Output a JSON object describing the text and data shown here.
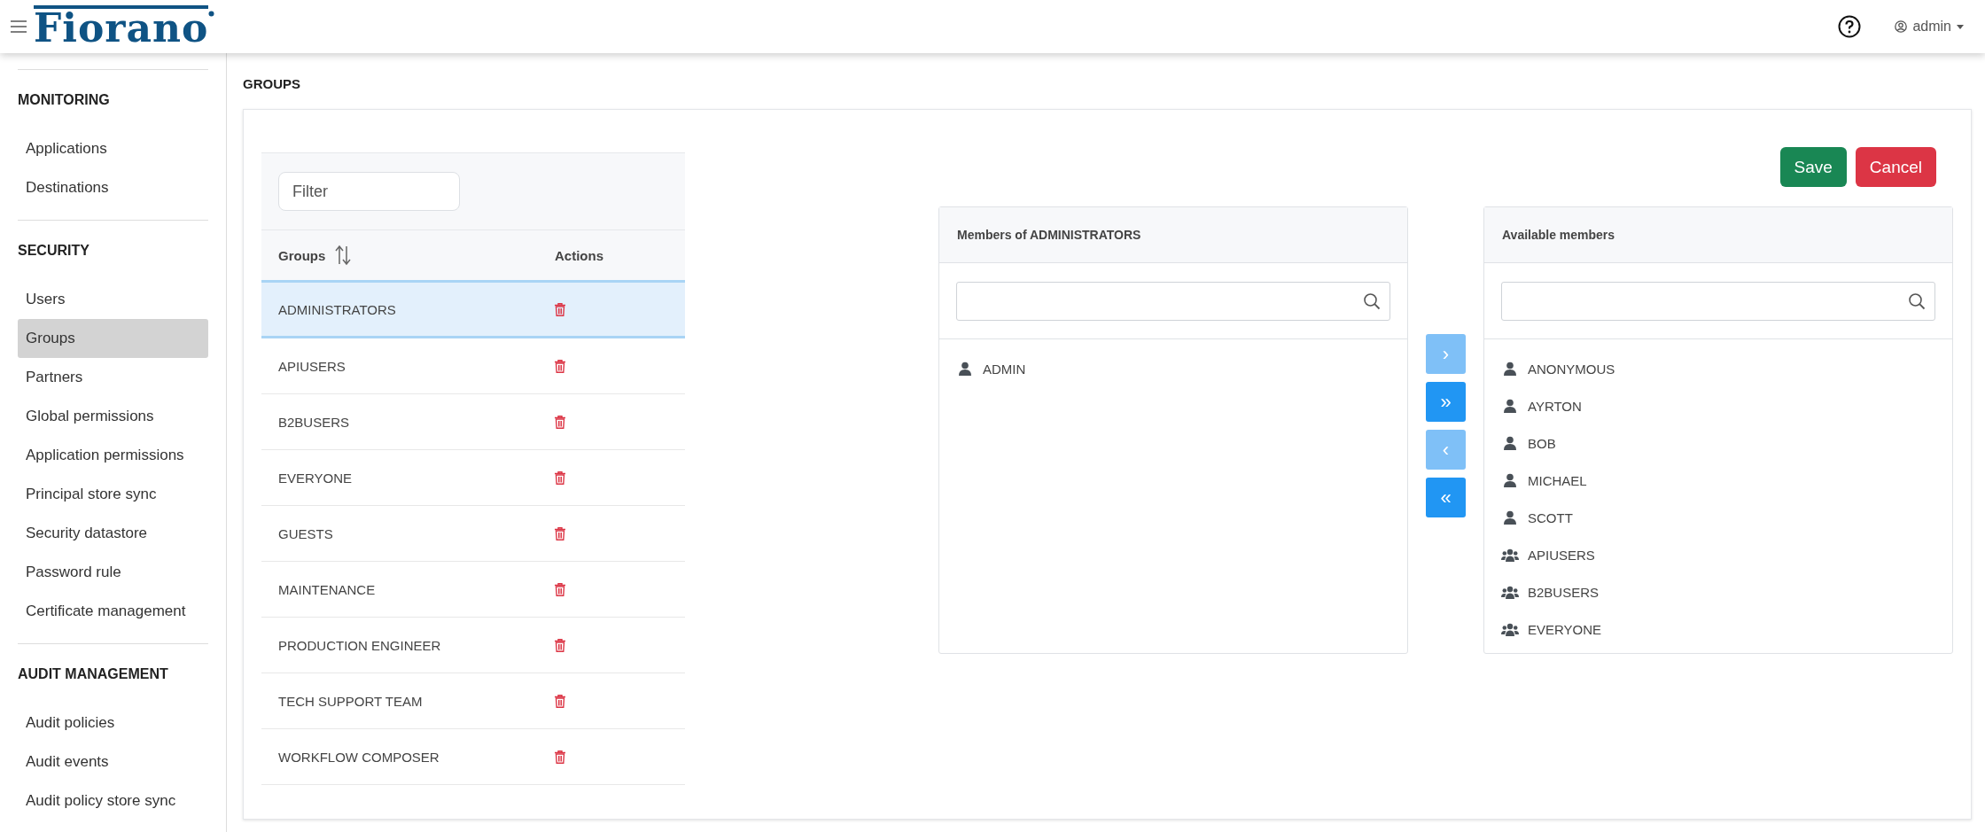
{
  "header": {
    "logo": "Fiorano",
    "user": "admin"
  },
  "sidebar": {
    "sections": [
      {
        "title": "MONITORING",
        "items": [
          {
            "label": "Applications",
            "selected": false
          },
          {
            "label": "Destinations",
            "selected": false
          }
        ]
      },
      {
        "title": "SECURITY",
        "items": [
          {
            "label": "Users",
            "selected": false
          },
          {
            "label": "Groups",
            "selected": true
          },
          {
            "label": "Partners",
            "selected": false
          },
          {
            "label": "Global permissions",
            "selected": false
          },
          {
            "label": "Application permissions",
            "selected": false
          },
          {
            "label": "Principal store sync",
            "selected": false
          },
          {
            "label": "Security datastore",
            "selected": false
          },
          {
            "label": "Password rule",
            "selected": false
          },
          {
            "label": "Certificate management",
            "selected": false
          }
        ]
      },
      {
        "title": "AUDIT MANAGEMENT",
        "items": [
          {
            "label": "Audit policies",
            "selected": false
          },
          {
            "label": "Audit events",
            "selected": false
          },
          {
            "label": "Audit policy store sync",
            "selected": false
          }
        ]
      }
    ]
  },
  "page_title": "GROUPS",
  "groups_table": {
    "filter": {
      "placeholder": "Filter"
    },
    "columns": [
      "Groups",
      "Actions"
    ],
    "rows": [
      {
        "name": "ADMINISTRATORS",
        "selected": true
      },
      {
        "name": "APIUSERS",
        "selected": false
      },
      {
        "name": "B2BUSERS",
        "selected": false
      },
      {
        "name": "EVERYONE",
        "selected": false
      },
      {
        "name": "GUESTS",
        "selected": false
      },
      {
        "name": "MAINTENANCE",
        "selected": false
      },
      {
        "name": "PRODUCTION ENGINEER",
        "selected": false
      },
      {
        "name": "TECH SUPPORT TEAM",
        "selected": false
      },
      {
        "name": "WORKFLOW COMPOSER",
        "selected": false
      }
    ]
  },
  "buttons": [
    "Save",
    "Cancel"
  ],
  "members": {
    "title": "Members of ADMINISTRATORS",
    "items": [
      {
        "name": "ADMIN",
        "kind": "user"
      }
    ]
  },
  "transfer_buttons": [
    {
      "label": "›",
      "disabled": true
    },
    {
      "label": "»",
      "disabled": false
    },
    {
      "label": "‹",
      "disabled": true
    },
    {
      "label": "«",
      "disabled": false
    }
  ],
  "available": {
    "title": "Available members",
    "items": [
      {
        "name": "ANONYMOUS",
        "kind": "user"
      },
      {
        "name": "AYRTON",
        "kind": "user"
      },
      {
        "name": "BOB",
        "kind": "user"
      },
      {
        "name": "MICHAEL",
        "kind": "user"
      },
      {
        "name": "SCOTT",
        "kind": "user"
      },
      {
        "name": "APIUSERS",
        "kind": "group"
      },
      {
        "name": "B2BUSERS",
        "kind": "group"
      },
      {
        "name": "EVERYONE",
        "kind": "group"
      }
    ]
  }
}
